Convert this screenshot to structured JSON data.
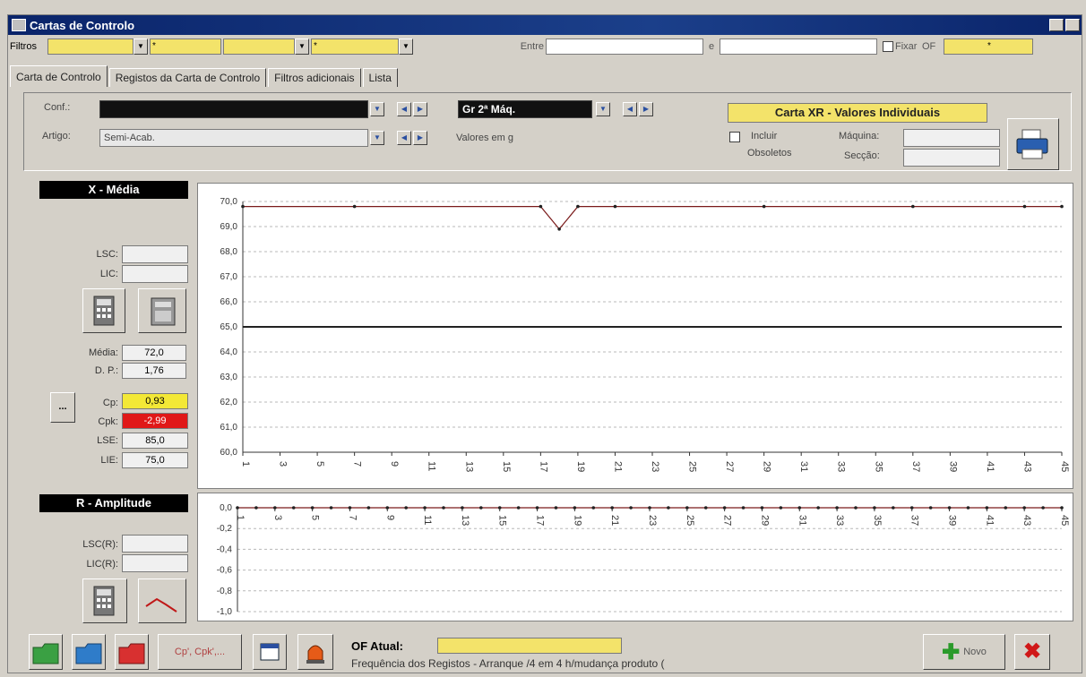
{
  "window": {
    "title": "Cartas de Controlo"
  },
  "filters": {
    "label": "Filtros",
    "combo2_value": "*",
    "combo4_value": "*",
    "entre_label": "Entre",
    "e_label": "e",
    "fixar_label": "Fixar",
    "of_label": "OF",
    "of_value": "*"
  },
  "tabs": [
    "Carta de Controlo",
    "Registos da Carta de Controlo",
    "Filtros adicionais",
    "Lista"
  ],
  "form": {
    "conf_label": "Conf.:",
    "conf_value": "",
    "group_value": "Gr 2ª Máq.",
    "artigo_label": "Artigo:",
    "artigo_value": "Semi-Acab.",
    "units_text": "Valores em g",
    "carta_title": "Carta XR - Valores Individuais",
    "incluir_label_1": "Incluir",
    "incluir_label_2": "Obsoletos",
    "maquina_label": "Máquina:",
    "seccao_label": "Secção:"
  },
  "xmedia": {
    "header": "X - Média",
    "lsc_label": "LSC:",
    "lic_label": "LIC:",
    "media_label": "Média:",
    "media_value": "72,0",
    "dp_label": "D. P.:",
    "dp_value": "1,76",
    "cp_label": "Cp:",
    "cp_value": "0,93",
    "cpk_label": "Cpk:",
    "cpk_value": "-2,99",
    "lse_label": "LSE:",
    "lse_value": "85,0",
    "lie_label": "LIE:",
    "lie_value": "75,0",
    "more_button": "..."
  },
  "ramp": {
    "header": "R - Amplitude",
    "lscr_label": "LSC(R):",
    "licr_label": "LIC(R):"
  },
  "bottom": {
    "cp_button": "Cp', Cpk',...",
    "of_atual_label": "OF Atual:",
    "of_atual_value": "",
    "freq_text": "Frequência dos Registos - Arranque /4 em 4 h/mudança produto (",
    "novo_label": "Novo"
  },
  "colors": {
    "yellow": "#f3e36a",
    "red": "#e01818",
    "titlebar": "#0a246a"
  },
  "chart_data": [
    {
      "type": "line",
      "title": "X - Média",
      "x": [
        1,
        3,
        5,
        7,
        9,
        11,
        13,
        15,
        17,
        19,
        21,
        23,
        25,
        27,
        29,
        31,
        33,
        35,
        37,
        39,
        41,
        43,
        45
      ],
      "x_ticks": [
        "1",
        "3",
        "5",
        "7",
        "9",
        "11",
        "13",
        "15",
        "17",
        "19",
        "21",
        "23",
        "25",
        "27",
        "29",
        "31",
        "33",
        "35",
        "37",
        "39",
        "41",
        "43",
        "45"
      ],
      "y_ticks": [
        "70,0",
        "69,0",
        "68,0",
        "67,0",
        "66,0",
        "65,0",
        "64,0",
        "63,0",
        "62,0",
        "61,0",
        "60,0"
      ],
      "ylim": [
        60,
        70
      ],
      "series": [
        {
          "points": [
            [
              1,
              69.8
            ],
            [
              7,
              69.8
            ],
            [
              17,
              69.8
            ],
            [
              18,
              68.9
            ],
            [
              19,
              69.8
            ],
            [
              21,
              69.8
            ],
            [
              29,
              69.8
            ],
            [
              37,
              69.8
            ],
            [
              43,
              69.8
            ],
            [
              45,
              69.8
            ]
          ]
        },
        {
          "points": [
            [
              1,
              65.0
            ],
            [
              45,
              65.0
            ]
          ]
        }
      ],
      "grid": true
    },
    {
      "type": "line",
      "title": "R - Amplitude",
      "x": [
        1,
        3,
        5,
        7,
        9,
        11,
        13,
        15,
        17,
        19,
        21,
        23,
        25,
        27,
        29,
        31,
        33,
        35,
        37,
        39,
        41,
        43,
        45
      ],
      "x_ticks": [
        "1",
        "3",
        "5",
        "7",
        "9",
        "11",
        "13",
        "15",
        "17",
        "19",
        "21",
        "23",
        "25",
        "27",
        "29",
        "31",
        "33",
        "35",
        "37",
        "39",
        "41",
        "43",
        "45"
      ],
      "y_ticks": [
        "0,0",
        "-0,2",
        "-0,4",
        "-0,6",
        "-0,8",
        "-1,0"
      ],
      "ylim": [
        -1.0,
        0.0
      ],
      "series": [
        {
          "points": [
            [
              1,
              0
            ],
            [
              2,
              0
            ],
            [
              3,
              0
            ],
            [
              4,
              0
            ],
            [
              5,
              0
            ],
            [
              6,
              0
            ],
            [
              7,
              0
            ],
            [
              8,
              0
            ],
            [
              9,
              0
            ],
            [
              10,
              0
            ],
            [
              11,
              0
            ],
            [
              12,
              0
            ],
            [
              13,
              0
            ],
            [
              14,
              0
            ],
            [
              15,
              0
            ],
            [
              16,
              0
            ],
            [
              17,
              0
            ],
            [
              18,
              0
            ],
            [
              19,
              0
            ],
            [
              20,
              0
            ],
            [
              21,
              0
            ],
            [
              22,
              0
            ],
            [
              23,
              0
            ],
            [
              24,
              0
            ],
            [
              25,
              0
            ],
            [
              26,
              0
            ],
            [
              27,
              0
            ],
            [
              28,
              0
            ],
            [
              29,
              0
            ],
            [
              30,
              0
            ],
            [
              31,
              0
            ],
            [
              32,
              0
            ],
            [
              33,
              0
            ],
            [
              34,
              0
            ],
            [
              35,
              0
            ],
            [
              36,
              0
            ],
            [
              37,
              0
            ],
            [
              38,
              0
            ],
            [
              39,
              0
            ],
            [
              40,
              0
            ],
            [
              41,
              0
            ],
            [
              42,
              0
            ],
            [
              43,
              0
            ],
            [
              44,
              0
            ],
            [
              45,
              0
            ]
          ]
        }
      ],
      "grid": true
    }
  ]
}
